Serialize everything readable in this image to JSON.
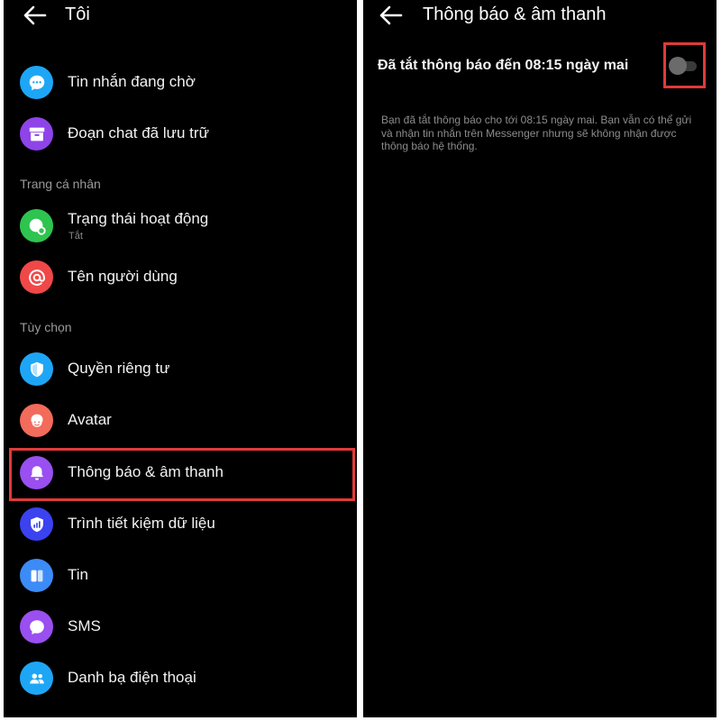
{
  "left_panel": {
    "title": "Tôi",
    "items_top": [
      {
        "label": "Tin nhắn đang chờ",
        "icon": "chat-bubble-icon",
        "color": "#1ea6f6"
      },
      {
        "label": "Đoạn chat đã lưu trữ",
        "icon": "archive-box-icon",
        "color": "#8e44e8"
      }
    ],
    "section_profile": "Trang cá nhân",
    "items_profile": [
      {
        "label": "Trạng thái hoạt động",
        "sub": "Tắt",
        "icon": "active-status-icon",
        "color": "#2ec44f"
      },
      {
        "label": "Tên người dùng",
        "icon": "at-sign-icon",
        "color": "#f04848"
      }
    ],
    "section_options": "Tùy chọn",
    "items_options": [
      {
        "label": "Quyền riêng tư",
        "icon": "shield-icon",
        "color": "#1ea6f6"
      },
      {
        "label": "Avatar",
        "icon": "avatar-face-icon",
        "color": "#f26b5b"
      },
      {
        "label": "Thông báo & âm thanh",
        "icon": "bell-icon",
        "color": "#9a4ff0"
      },
      {
        "label": "Trình tiết kiệm dữ liệu",
        "icon": "data-saver-icon",
        "color": "#3b42f0"
      },
      {
        "label": "Tin",
        "icon": "stories-icon",
        "color": "#3d8bf7"
      },
      {
        "label": "SMS",
        "icon": "sms-bubble-icon",
        "color": "#9a4ff0"
      },
      {
        "label": "Danh bạ điện thoại",
        "icon": "contacts-icon",
        "color": "#1ea6f6"
      }
    ]
  },
  "right_panel": {
    "title": "Thông báo & âm thanh",
    "dnd_label": "Đã tắt thông báo đến 08:15 ngày mai",
    "toggle_state": "off",
    "description_lines": [
      "Bạn đã tắt thông báo cho tới 08:15 ngày mai. Bạn vẫn có thể gửi",
      "và nhận tin nhắn trên Messenger nhưng sẽ không nhận được",
      "thông báo hệ thống."
    ]
  },
  "colors": {
    "background": "#000000",
    "highlight": "#e03a3a"
  }
}
